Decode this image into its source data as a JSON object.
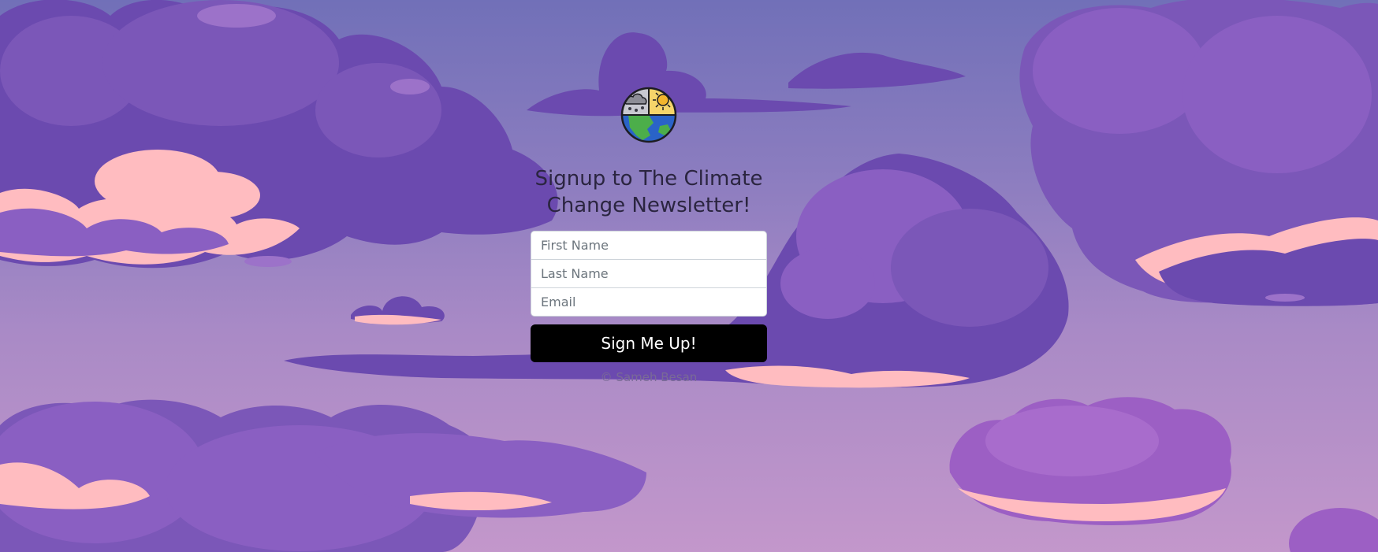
{
  "page": {
    "heading": "Signup to The Climate Change Newsletter!",
    "logo_icon": "climate-globe-icon"
  },
  "form": {
    "first_name_placeholder": "First Name",
    "last_name_placeholder": "Last Name",
    "email_placeholder": "Email",
    "submit_label": "Sign Me Up!"
  },
  "footer": {
    "copyright": "© Sameh Besan"
  },
  "colors": {
    "button": "#000000",
    "sky_top": "#7170b8",
    "sky_bottom": "#c397cb",
    "cloud": "#7b57b8",
    "cloud_dark": "#5e3d9e",
    "cloud_light": "#9c72c9",
    "cloud_edge": "#ffbcc0"
  }
}
